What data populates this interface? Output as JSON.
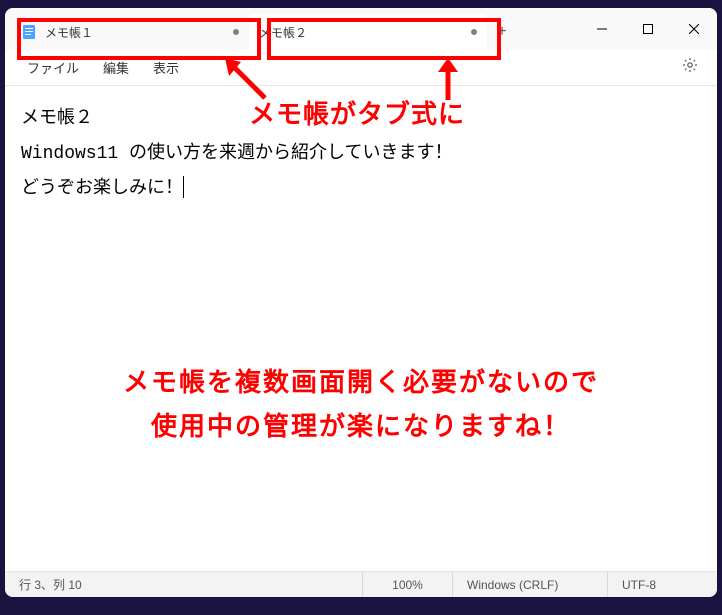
{
  "tabs": [
    {
      "label": "メモ帳１",
      "active": false,
      "modified": true
    },
    {
      "label": "メモ帳２",
      "active": true,
      "modified": true
    }
  ],
  "new_tab_label": "+",
  "window_controls": {
    "minimize": "−",
    "maximize": "□",
    "close": "×"
  },
  "menu": {
    "file": "ファイル",
    "edit": "編集",
    "view": "表示"
  },
  "editor": {
    "line1": "メモ帳２",
    "line2": "Windows11 の使い方を来週から紹介していきます！",
    "line3": "どうぞお楽しみに！"
  },
  "status": {
    "position": "行 3、列 10",
    "zoom": "100%",
    "eol": "Windows (CRLF)",
    "encoding": "UTF-8"
  },
  "annotations": {
    "callout1": "メモ帳がタブ式に",
    "callout2_l1": "メモ帳を複数画面開く必要がないので",
    "callout2_l2": "使用中の管理が楽になりますね！"
  }
}
